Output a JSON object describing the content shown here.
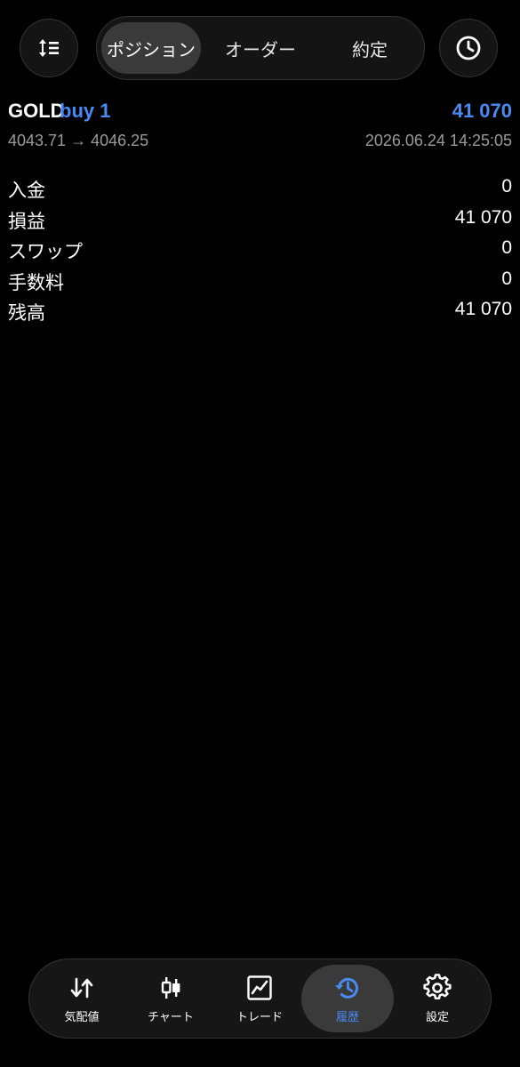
{
  "header": {
    "sort_icon": "sort-lines-icon",
    "history_icon": "clock-icon",
    "tabs": [
      {
        "label": "ポジション",
        "active": true
      },
      {
        "label": "オーダー",
        "active": false
      },
      {
        "label": "約定",
        "active": false
      }
    ]
  },
  "deal": {
    "symbol": "GOLD",
    "side": "buy 1",
    "profit": "41 070",
    "prices": "4043.71 → 4046.25",
    "time": "2026.06.24 14:25:05"
  },
  "summary": [
    {
      "label": "入金",
      "value": "0"
    },
    {
      "label": "損益",
      "value": "41 070"
    },
    {
      "label": "スワップ",
      "value": "0"
    },
    {
      "label": "手数料",
      "value": "0"
    },
    {
      "label": "残高",
      "value": "41 070"
    }
  ],
  "nav": [
    {
      "label": "気配値",
      "icon": "up-down-arrows-icon",
      "active": false
    },
    {
      "label": "チャート",
      "icon": "candlestick-icon",
      "active": false
    },
    {
      "label": "トレード",
      "icon": "line-chart-icon",
      "active": false
    },
    {
      "label": "履歴",
      "icon": "history-icon",
      "active": true
    },
    {
      "label": "設定",
      "icon": "gear-icon",
      "active": false
    }
  ],
  "colors": {
    "accent": "#4a8af4",
    "background": "#000000",
    "muted": "#9a9a9a"
  }
}
